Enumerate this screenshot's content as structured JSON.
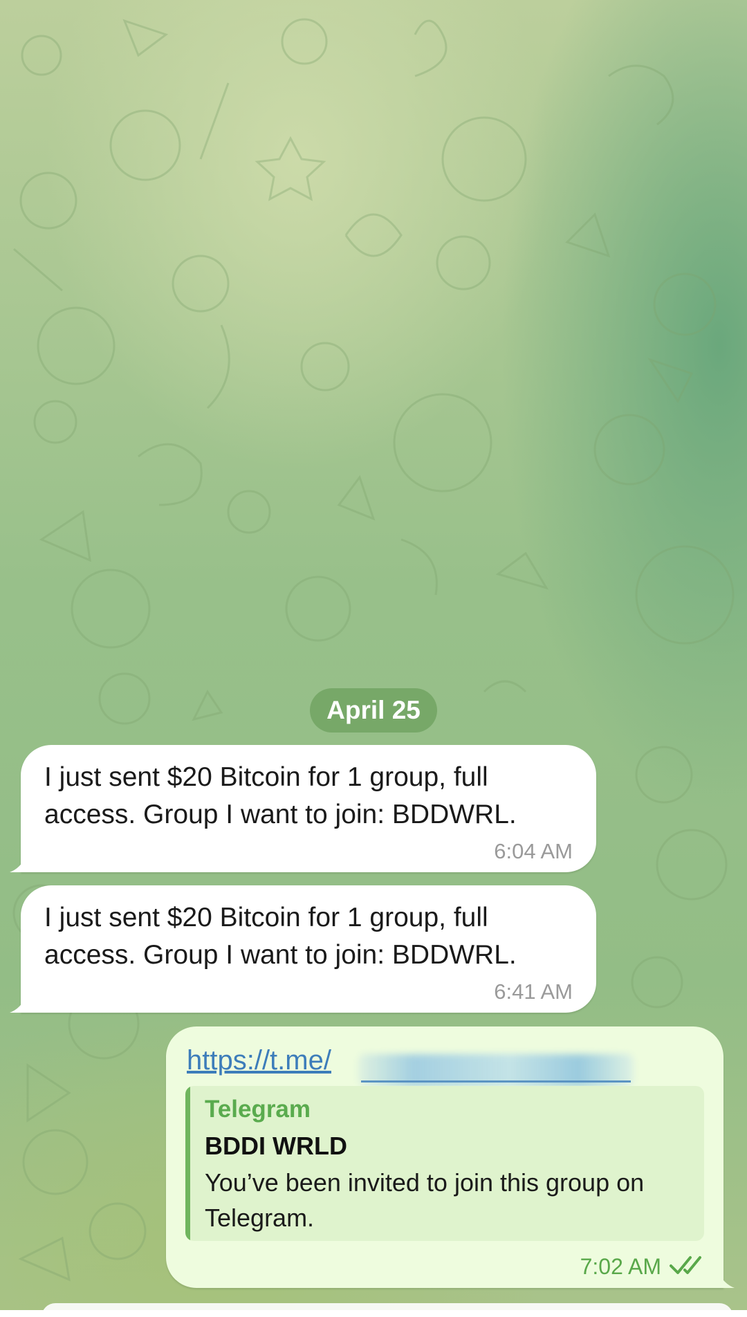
{
  "date_divider": "April 25",
  "messages": [
    {
      "direction": "incoming",
      "text": "I just sent $20 Bitcoin for 1 group, full access. Group I want to join: BDDWRL.",
      "time": "6:04 AM"
    },
    {
      "direction": "incoming",
      "text": "I just sent $20 Bitcoin for 1 group, full access. Group I want to join: BDDWRL.",
      "time": "6:41 AM"
    }
  ],
  "outgoing": {
    "link_text": "https://t.me/",
    "link_preview": {
      "site_name": "Telegram",
      "title": "BDDI WRLD",
      "description": "You’ve been invited to join this group on Telegram."
    },
    "time": "7:02 AM",
    "status_icon": "double-check-icon"
  },
  "colors": {
    "date_chip_bg": "#77a868",
    "incoming_bubble": "#ffffff",
    "outgoing_bubble": "#eefcde",
    "link": "#3d7dba",
    "preview_accent": "#6fb55e",
    "outgoing_meta": "#59a84a"
  }
}
